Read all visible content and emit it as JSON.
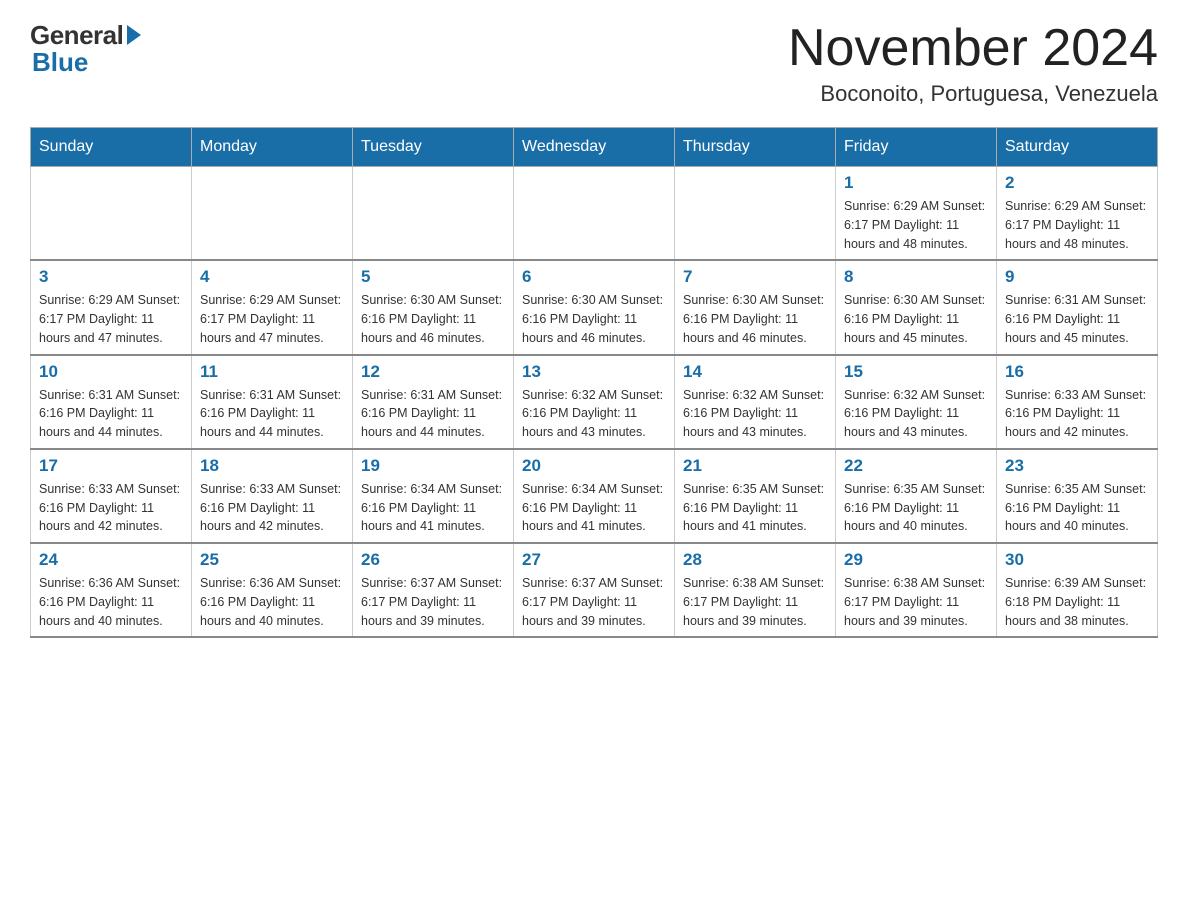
{
  "logo": {
    "general": "General",
    "blue": "Blue"
  },
  "title": "November 2024",
  "subtitle": "Boconoito, Portuguesa, Venezuela",
  "days_of_week": [
    "Sunday",
    "Monday",
    "Tuesday",
    "Wednesday",
    "Thursday",
    "Friday",
    "Saturday"
  ],
  "weeks": [
    [
      {
        "day": "",
        "info": ""
      },
      {
        "day": "",
        "info": ""
      },
      {
        "day": "",
        "info": ""
      },
      {
        "day": "",
        "info": ""
      },
      {
        "day": "",
        "info": ""
      },
      {
        "day": "1",
        "info": "Sunrise: 6:29 AM\nSunset: 6:17 PM\nDaylight: 11 hours and 48 minutes."
      },
      {
        "day": "2",
        "info": "Sunrise: 6:29 AM\nSunset: 6:17 PM\nDaylight: 11 hours and 48 minutes."
      }
    ],
    [
      {
        "day": "3",
        "info": "Sunrise: 6:29 AM\nSunset: 6:17 PM\nDaylight: 11 hours and 47 minutes."
      },
      {
        "day": "4",
        "info": "Sunrise: 6:29 AM\nSunset: 6:17 PM\nDaylight: 11 hours and 47 minutes."
      },
      {
        "day": "5",
        "info": "Sunrise: 6:30 AM\nSunset: 6:16 PM\nDaylight: 11 hours and 46 minutes."
      },
      {
        "day": "6",
        "info": "Sunrise: 6:30 AM\nSunset: 6:16 PM\nDaylight: 11 hours and 46 minutes."
      },
      {
        "day": "7",
        "info": "Sunrise: 6:30 AM\nSunset: 6:16 PM\nDaylight: 11 hours and 46 minutes."
      },
      {
        "day": "8",
        "info": "Sunrise: 6:30 AM\nSunset: 6:16 PM\nDaylight: 11 hours and 45 minutes."
      },
      {
        "day": "9",
        "info": "Sunrise: 6:31 AM\nSunset: 6:16 PM\nDaylight: 11 hours and 45 minutes."
      }
    ],
    [
      {
        "day": "10",
        "info": "Sunrise: 6:31 AM\nSunset: 6:16 PM\nDaylight: 11 hours and 44 minutes."
      },
      {
        "day": "11",
        "info": "Sunrise: 6:31 AM\nSunset: 6:16 PM\nDaylight: 11 hours and 44 minutes."
      },
      {
        "day": "12",
        "info": "Sunrise: 6:31 AM\nSunset: 6:16 PM\nDaylight: 11 hours and 44 minutes."
      },
      {
        "day": "13",
        "info": "Sunrise: 6:32 AM\nSunset: 6:16 PM\nDaylight: 11 hours and 43 minutes."
      },
      {
        "day": "14",
        "info": "Sunrise: 6:32 AM\nSunset: 6:16 PM\nDaylight: 11 hours and 43 minutes."
      },
      {
        "day": "15",
        "info": "Sunrise: 6:32 AM\nSunset: 6:16 PM\nDaylight: 11 hours and 43 minutes."
      },
      {
        "day": "16",
        "info": "Sunrise: 6:33 AM\nSunset: 6:16 PM\nDaylight: 11 hours and 42 minutes."
      }
    ],
    [
      {
        "day": "17",
        "info": "Sunrise: 6:33 AM\nSunset: 6:16 PM\nDaylight: 11 hours and 42 minutes."
      },
      {
        "day": "18",
        "info": "Sunrise: 6:33 AM\nSunset: 6:16 PM\nDaylight: 11 hours and 42 minutes."
      },
      {
        "day": "19",
        "info": "Sunrise: 6:34 AM\nSunset: 6:16 PM\nDaylight: 11 hours and 41 minutes."
      },
      {
        "day": "20",
        "info": "Sunrise: 6:34 AM\nSunset: 6:16 PM\nDaylight: 11 hours and 41 minutes."
      },
      {
        "day": "21",
        "info": "Sunrise: 6:35 AM\nSunset: 6:16 PM\nDaylight: 11 hours and 41 minutes."
      },
      {
        "day": "22",
        "info": "Sunrise: 6:35 AM\nSunset: 6:16 PM\nDaylight: 11 hours and 40 minutes."
      },
      {
        "day": "23",
        "info": "Sunrise: 6:35 AM\nSunset: 6:16 PM\nDaylight: 11 hours and 40 minutes."
      }
    ],
    [
      {
        "day": "24",
        "info": "Sunrise: 6:36 AM\nSunset: 6:16 PM\nDaylight: 11 hours and 40 minutes."
      },
      {
        "day": "25",
        "info": "Sunrise: 6:36 AM\nSunset: 6:16 PM\nDaylight: 11 hours and 40 minutes."
      },
      {
        "day": "26",
        "info": "Sunrise: 6:37 AM\nSunset: 6:17 PM\nDaylight: 11 hours and 39 minutes."
      },
      {
        "day": "27",
        "info": "Sunrise: 6:37 AM\nSunset: 6:17 PM\nDaylight: 11 hours and 39 minutes."
      },
      {
        "day": "28",
        "info": "Sunrise: 6:38 AM\nSunset: 6:17 PM\nDaylight: 11 hours and 39 minutes."
      },
      {
        "day": "29",
        "info": "Sunrise: 6:38 AM\nSunset: 6:17 PM\nDaylight: 11 hours and 39 minutes."
      },
      {
        "day": "30",
        "info": "Sunrise: 6:39 AM\nSunset: 6:18 PM\nDaylight: 11 hours and 38 minutes."
      }
    ]
  ]
}
